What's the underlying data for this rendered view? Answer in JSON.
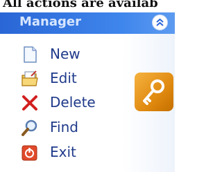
{
  "banner": {
    "text": "All actions are availab"
  },
  "panel": {
    "title": "Manager",
    "items": [
      {
        "label": "New",
        "icon": "new-document-icon"
      },
      {
        "label": "Edit",
        "icon": "edit-folder-icon"
      },
      {
        "label": "Delete",
        "icon": "delete-x-icon"
      },
      {
        "label": "Find",
        "icon": "magnifier-icon"
      },
      {
        "label": "Exit",
        "icon": "exit-power-icon"
      }
    ]
  },
  "colors": {
    "header_blue": "#2a66d6",
    "label_blue": "#1f3a8a",
    "key_orange": "#e08a10",
    "delete_red": "#d21f1f"
  },
  "icons": {
    "collapse": "double-chevron-up-icon",
    "side_tile": "key-icon"
  }
}
